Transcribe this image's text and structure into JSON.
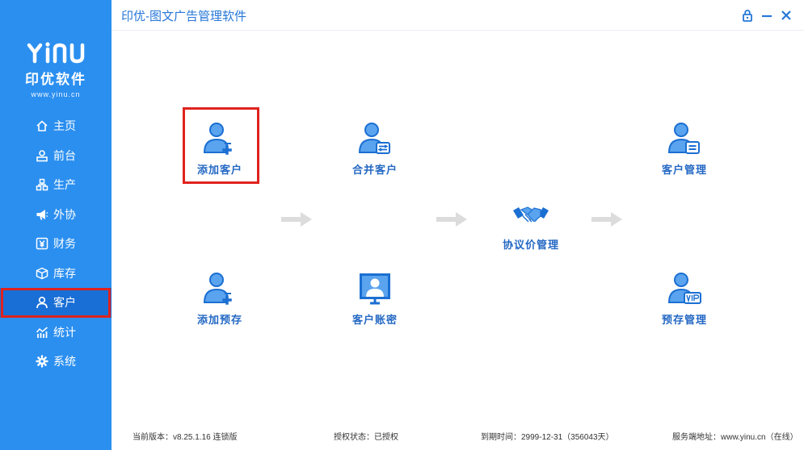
{
  "app": {
    "title": "印优-图文广告管理软件",
    "accent_color": "#2b8ff0",
    "highlight_color": "#e0221e"
  },
  "logo": {
    "mark": "YINU",
    "name": "印优软件",
    "url": "www.yinu.cn"
  },
  "window_controls": [
    {
      "icon": "lock-icon"
    },
    {
      "icon": "minimize-icon"
    },
    {
      "icon": "close-icon"
    }
  ],
  "sidebar": {
    "items": [
      {
        "label": "主页",
        "icon": "home-icon",
        "active": false
      },
      {
        "label": "前台",
        "icon": "front-desk-icon",
        "active": false
      },
      {
        "label": "生产",
        "icon": "production-icon",
        "active": false
      },
      {
        "label": "外协",
        "icon": "outsource-icon",
        "active": false
      },
      {
        "label": "财务",
        "icon": "finance-icon",
        "active": false
      },
      {
        "label": "库存",
        "icon": "inventory-icon",
        "active": false
      },
      {
        "label": "客户",
        "icon": "customer-icon",
        "active": true
      },
      {
        "label": "统计",
        "icon": "statistics-icon",
        "active": false
      },
      {
        "label": "系统",
        "icon": "settings-icon",
        "active": false
      }
    ]
  },
  "main": {
    "tiles": {
      "add_customer": {
        "label": "添加客户",
        "icon": "add-customer-icon",
        "selected": true
      },
      "merge_customer": {
        "label": "合并客户",
        "icon": "merge-customer-icon"
      },
      "customer_manage": {
        "label": "客户管理",
        "icon": "customer-manage-icon"
      },
      "agreement_price": {
        "label": "协议价管理",
        "icon": "handshake-icon"
      },
      "add_prepaid": {
        "label": "添加预存",
        "icon": "add-prepaid-icon"
      },
      "customer_account": {
        "label": "客户账密",
        "icon": "customer-account-icon"
      },
      "prepaid_manage": {
        "label": "预存管理",
        "icon": "vip-icon"
      }
    }
  },
  "footer": {
    "version": "当前版本：v8.25.1.16  连锁版",
    "license": "授权状态：已授权",
    "expiry": "到期时间：2999-12-31（356043天）",
    "server": "服务端地址：www.yinu.cn（在线）"
  }
}
